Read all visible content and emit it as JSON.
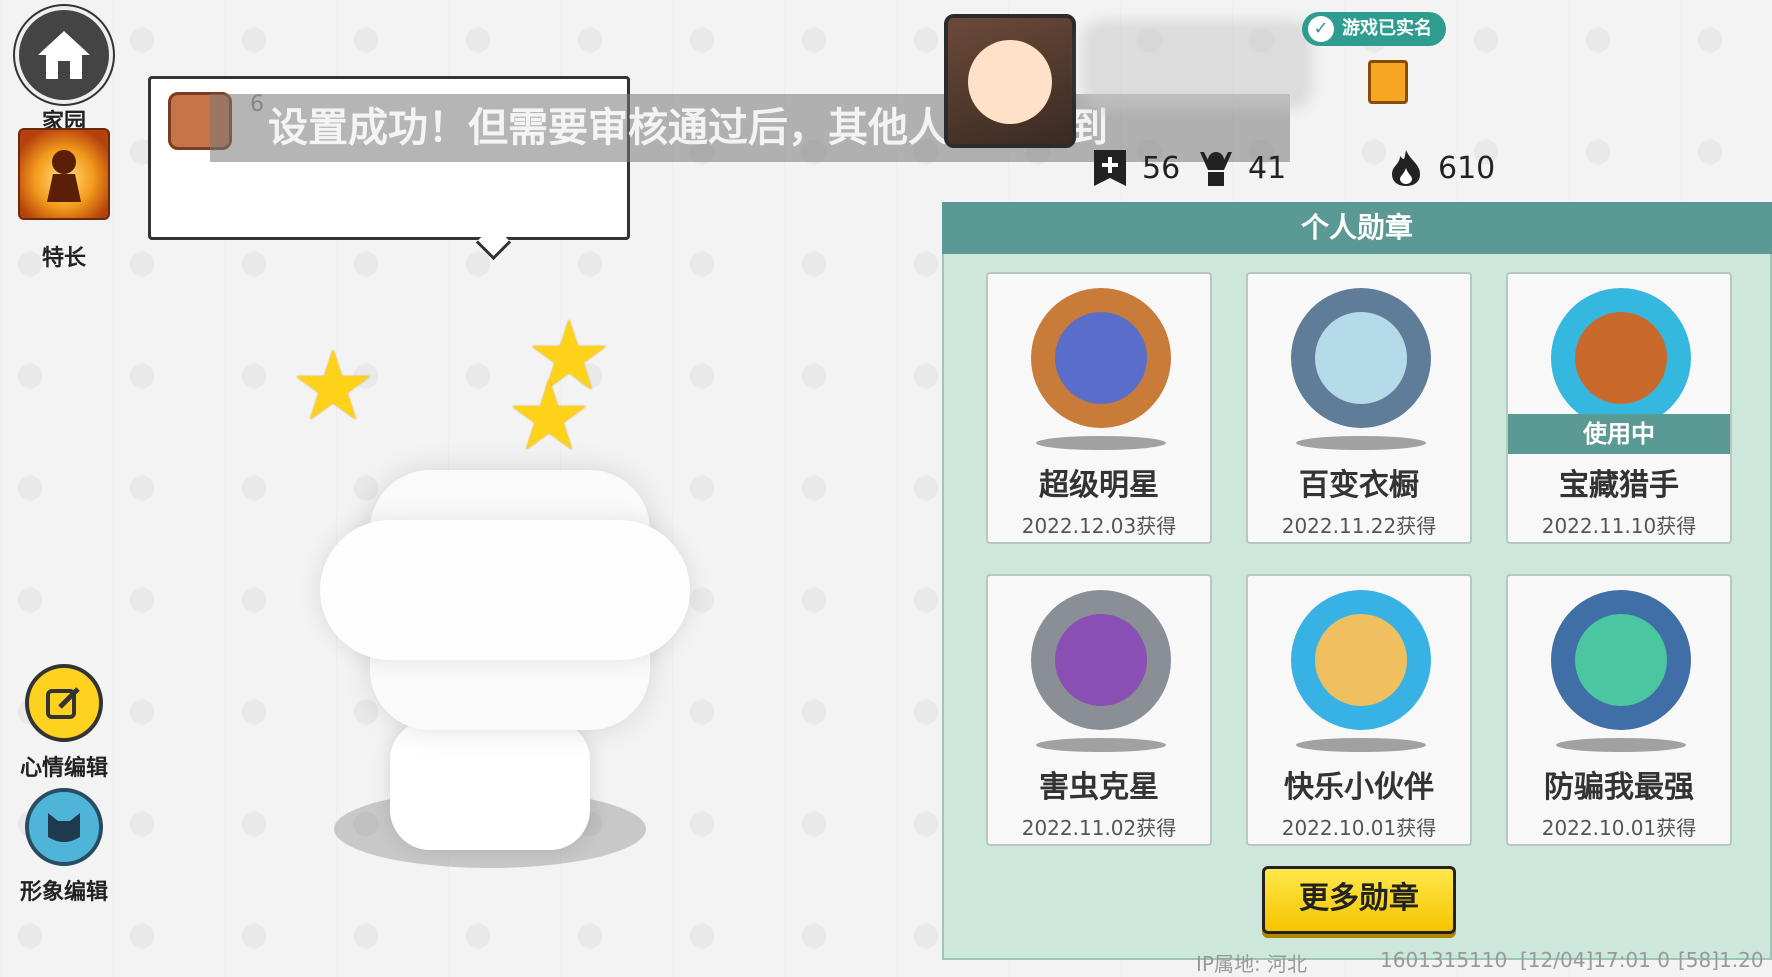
{
  "sidebar": {
    "home_label": "家园",
    "skill_label": "特长",
    "mood_label": "心情编辑",
    "image_label": "形象编辑"
  },
  "bubble": {
    "count": "6"
  },
  "toast": {
    "text": "设置成功！但需要审核通过后，其他人才能看到"
  },
  "profile": {
    "verified_label": "游戏已实名",
    "stats": {
      "friends": "56",
      "followers": "41",
      "heat": "610"
    }
  },
  "medals": {
    "title": "个人勋章",
    "in_use_label": "使用中",
    "more_label": "更多勋章",
    "items": [
      {
        "name": "超级明星",
        "date": "2022.12.03获得",
        "color": "#c97b3a",
        "inner": "#5a6ec9"
      },
      {
        "name": "百变衣橱",
        "date": "2022.11.22获得",
        "color": "#5f7c99",
        "inner": "#b5dbe8"
      },
      {
        "name": "宝藏猎手",
        "date": "2022.11.10获得",
        "color": "#34b8e0",
        "inner": "#c96a2c"
      },
      {
        "name": "害虫克星",
        "date": "2022.11.02获得",
        "color": "#8a8f96",
        "inner": "#8a4fb5"
      },
      {
        "name": "快乐小伙伴",
        "date": "2022.10.01获得",
        "color": "#38b2e4",
        "inner": "#f0c060"
      },
      {
        "name": "防骗我最强",
        "date": "2022.10.01获得",
        "color": "#3f6fa6",
        "inner": "#4ac6a0"
      }
    ]
  },
  "footer": {
    "ip": "IP属地: 河北",
    "uid": "1601315110",
    "time": "[12/04]17:01 0",
    "version": "[58]1.20"
  }
}
